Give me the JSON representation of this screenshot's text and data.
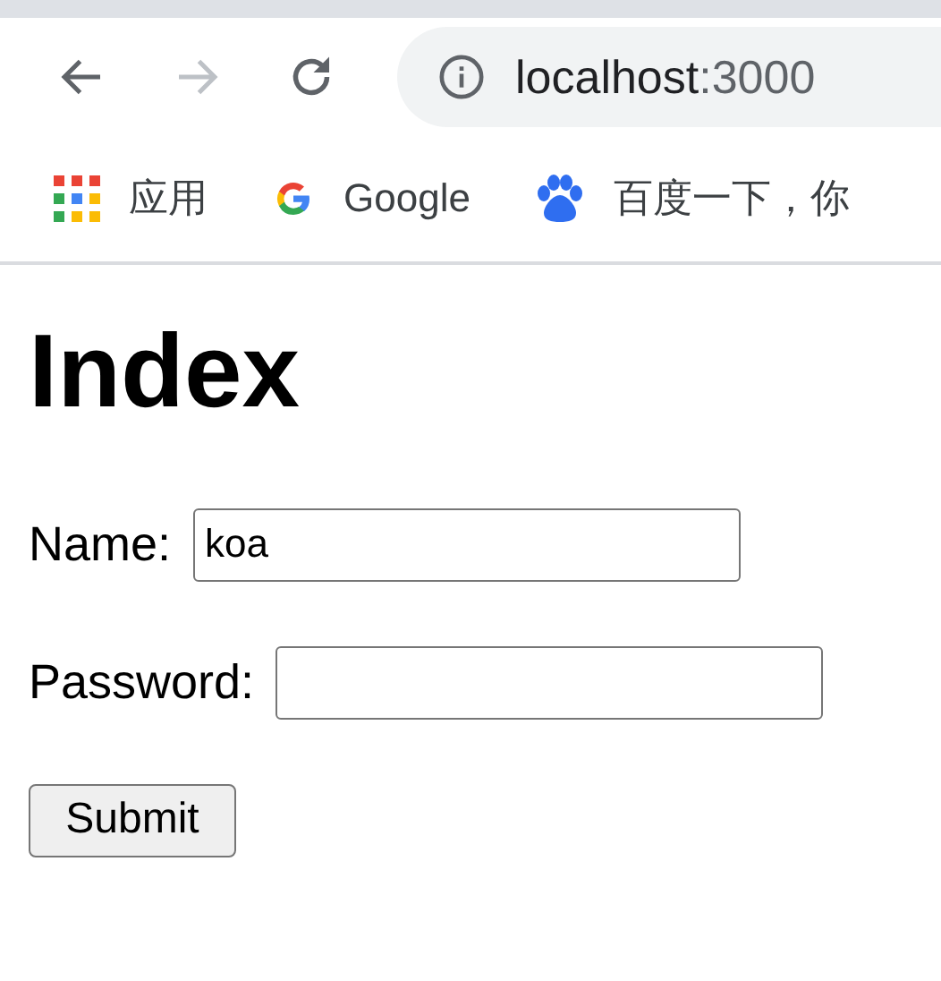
{
  "toolbar": {
    "back": {
      "disabled": false
    },
    "forward": {
      "disabled": true
    },
    "address": {
      "host": "localhost",
      "port": ":3000"
    }
  },
  "bookmarks": [
    {
      "kind": "apps",
      "label": "应用"
    },
    {
      "kind": "google",
      "label": "Google"
    },
    {
      "kind": "paw",
      "label": "百度一下，你"
    }
  ],
  "page": {
    "heading": "Index",
    "fields": [
      {
        "label": "Name:",
        "value": "koa"
      },
      {
        "label": "Password:"
      }
    ],
    "submit": "Submit"
  }
}
